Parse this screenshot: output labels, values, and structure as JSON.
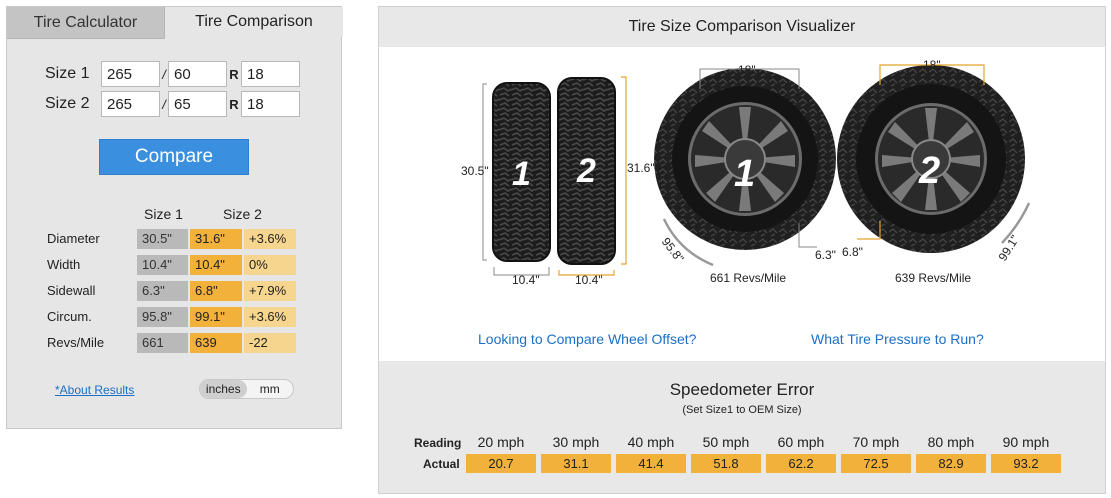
{
  "tabs": {
    "calculator": "Tire Calculator",
    "comparison": "Tire Comparison"
  },
  "size1": {
    "label": "Size 1",
    "width": "265",
    "aspect": "60",
    "rim": "18"
  },
  "size2": {
    "label": "Size 2",
    "width": "265",
    "aspect": "65",
    "rim": "18"
  },
  "separators": {
    "slash": "/",
    "r": "R"
  },
  "compare_button": "Compare",
  "results": {
    "headers": {
      "size1": "Size 1",
      "size2": "Size 2"
    },
    "rows": [
      {
        "label": "Diameter",
        "size1": "30.5\"",
        "size2": "31.6\"",
        "diff": "+3.6%"
      },
      {
        "label": "Width",
        "size1": "10.4\"",
        "size2": "10.4\"",
        "diff": "0%"
      },
      {
        "label": "Sidewall",
        "size1": "6.3\"",
        "size2": "6.8\"",
        "diff": "+7.9%"
      },
      {
        "label": "Circum.",
        "size1": "95.8\"",
        "size2": "99.1\"",
        "diff": "+3.6%"
      },
      {
        "label": "Revs/Mile",
        "size1": "661",
        "size2": "639",
        "diff": "-22"
      }
    ],
    "about_link": "*About Results",
    "units": {
      "inches": "inches",
      "mm": "mm",
      "active": "inches"
    }
  },
  "visualizer": {
    "title": "Tire Size Comparison Visualizer",
    "side_view": {
      "tire1_number": "1",
      "tire2_number": "2",
      "height1": "30.5\"",
      "height2": "31.6\"",
      "width1": "10.4\"",
      "width2": "10.4\""
    },
    "wheel1": {
      "number": "1",
      "rim": "18\"",
      "sidewall": "6.3\"",
      "circumference": "95.8\"",
      "revs": "661 Revs/Mile"
    },
    "wheel2": {
      "number": "2",
      "rim": "18\"",
      "sidewall": "6.8\"",
      "circumference": "99.1\"",
      "revs": "639 Revs/Mile"
    },
    "links": {
      "offset": "Looking to Compare Wheel Offset?",
      "pressure": "What Tire Pressure to Run?"
    },
    "accent_color": "#f2b13b",
    "link_color": "#1b6fc7"
  },
  "speedometer": {
    "title": "Speedometer Error",
    "subtitle": "(Set Size1 to OEM Size)",
    "reading_label": "Reading",
    "actual_label": "Actual",
    "readings": [
      "20 mph",
      "30 mph",
      "40 mph",
      "50 mph",
      "60 mph",
      "70 mph",
      "80 mph",
      "90 mph"
    ],
    "actuals": [
      "20.7",
      "31.1",
      "41.4",
      "51.8",
      "62.2",
      "72.5",
      "82.9",
      "93.2"
    ]
  }
}
